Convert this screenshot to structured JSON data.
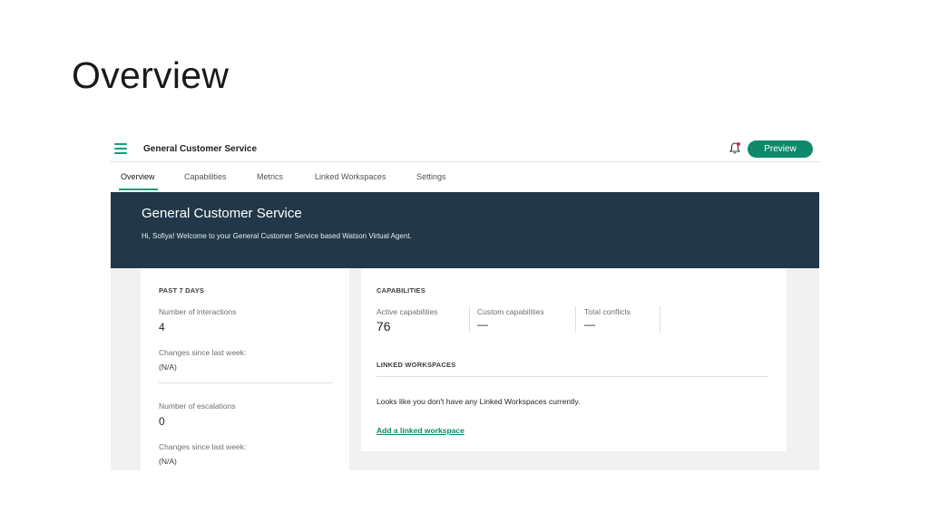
{
  "slide": {
    "title": "Overview"
  },
  "header": {
    "app_name": "General Customer Service",
    "preview_label": "Preview"
  },
  "tabs": [
    {
      "label": "Overview",
      "active": true
    },
    {
      "label": "Capabilities"
    },
    {
      "label": "Metrics"
    },
    {
      "label": "Linked Workspaces"
    },
    {
      "label": "Settings"
    }
  ],
  "banner": {
    "title": "General Customer Service",
    "subtitle": "Hi, Sofiya! Welcome to your General Customer Service based Watson Virtual Agent."
  },
  "past7": {
    "heading": "PAST 7 DAYS",
    "interactions_label": "Number of interactions",
    "interactions_value": "4",
    "interactions_change_label": "Changes since last week:",
    "interactions_change_value": "(N/A)",
    "escalations_label": "Number of escalations",
    "escalations_value": "0",
    "escalations_change_label": "Changes since last week:",
    "escalations_change_value": "(N/A)"
  },
  "capabilities": {
    "heading": "CAPABILITIES",
    "active_label": "Active capabilities",
    "active_value": "76",
    "custom_label": "Custom capabilities",
    "custom_value": "—",
    "conflicts_label": "Total conflicts",
    "conflicts_value": "—"
  },
  "linked": {
    "heading": "LINKED WORKSPACES",
    "empty_message": "Looks like you don't have any Linked Workspaces currently.",
    "add_link": "Add a linked workspace"
  },
  "colors": {
    "accent": "#0e8a6a",
    "banner": "#223849"
  },
  "icons": {
    "menu": "hamburger-menu-icon",
    "notifications": "bell-icon"
  }
}
